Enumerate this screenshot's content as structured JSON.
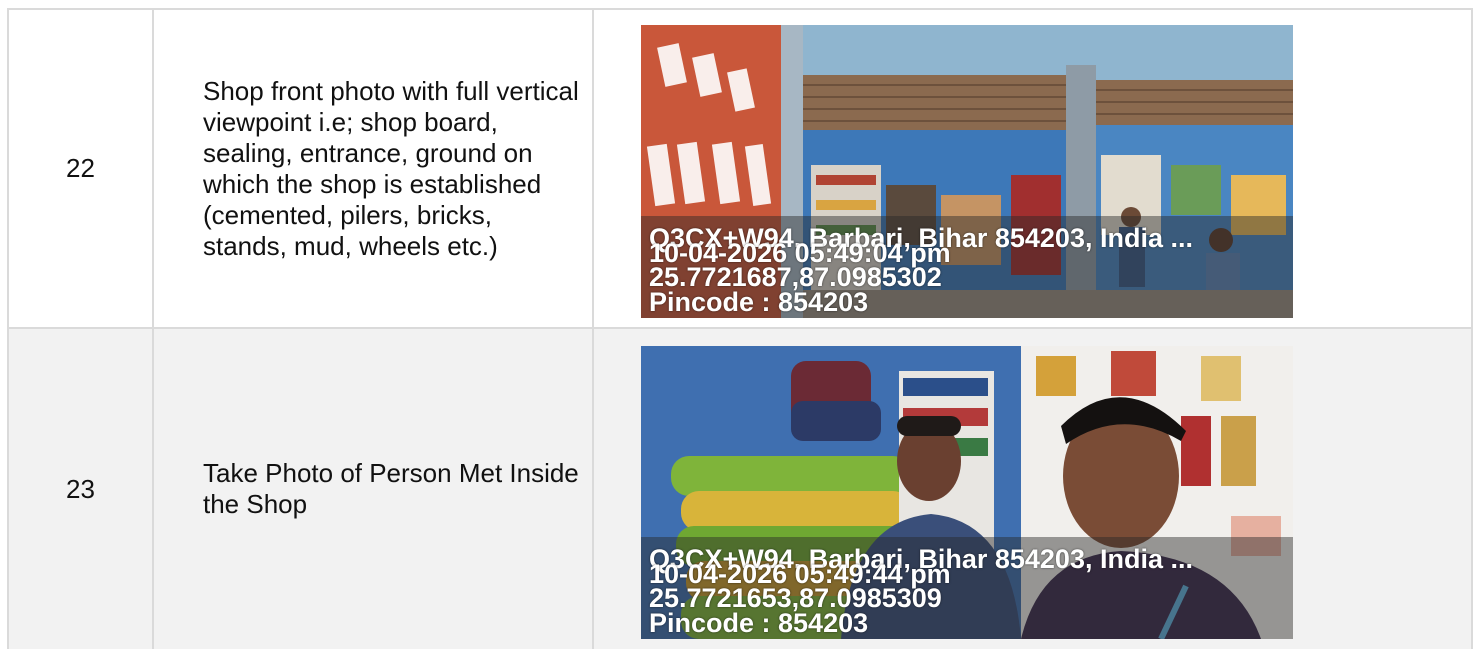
{
  "rows": [
    {
      "number": "22",
      "description": "Shop front photo with full vertical viewpoint i.e; shop board, sealing, entrance, ground on which the shop is established (cemented, pilers, bricks, stands, mud, wheels etc.)",
      "photo": {
        "address": "Q3CX+W94, Barbari, Bihar 854203, India ...",
        "datetime": "10-04-2026 05:49:04 pm",
        "coords": "25.7721687,87.0985302",
        "pincode": "Pincode : 854203"
      }
    },
    {
      "number": "23",
      "description": "Take Photo of Person Met Inside the Shop",
      "photo": {
        "address": "Q3CX+W94, Barbari, Bihar 854203, India ...",
        "datetime": "10-04-2026 05:49:44 pm",
        "coords": "25.7721653,87.0985309",
        "pincode": "Pincode : 854203"
      }
    }
  ]
}
